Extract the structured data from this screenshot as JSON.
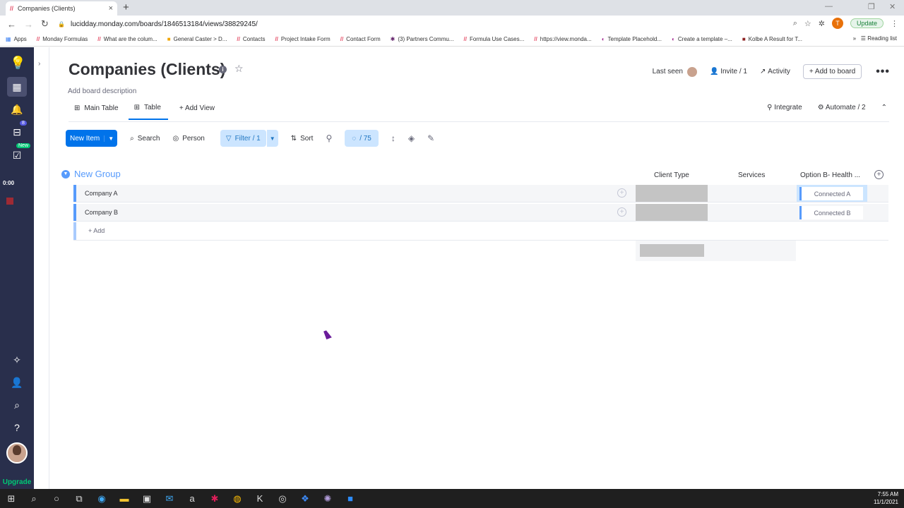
{
  "browser": {
    "tab_title": "Companies (Clients)",
    "url": "lucidday.monday.com/boards/1846513184/views/38829245/",
    "update_label": "Update",
    "profile_initial": "T",
    "bookmarks": [
      "Apps",
      "Monday Formulas",
      "What are the colum...",
      "General Caster > D...",
      "Contacts",
      "Project Intake Form",
      "Contact Form",
      "(3) Partners Commu...",
      "Formula Use Cases...",
      "https://view.monda...",
      "Template Placehold...",
      "Create a template –...",
      "Kolbe A Result for T..."
    ],
    "reading_list": "Reading list"
  },
  "sidebar": {
    "inbox_badge": "8",
    "new_badge": "New",
    "timer": "0:00",
    "upgrade": "Upgrade"
  },
  "board": {
    "title": "Companies (Clients)",
    "description": "Add board description",
    "last_seen": "Last seen",
    "invite": "Invite / 1",
    "activity": "Activity",
    "add_to_board": "Add to board",
    "more": "•••"
  },
  "views": {
    "main_table": "Main Table",
    "table": "Table",
    "add_view": "+ Add View",
    "integrate": "Integrate",
    "automate": "Automate / 2"
  },
  "toolbar": {
    "new_item": "New Item",
    "search": "Search",
    "person": "Person",
    "filter": "Filter / 1",
    "sort": "Sort",
    "hidden": "/ 75"
  },
  "group": {
    "title": "New Group",
    "columns": [
      "Client Type",
      "Services",
      "Option B- Health ..."
    ],
    "rows": [
      {
        "name": "Company A",
        "connected": "Connected A"
      },
      {
        "name": "Company B",
        "connected": "Connected B"
      }
    ],
    "add_label": "+ Add"
  },
  "taskbar": {
    "time": "7:55 AM",
    "date": "11/1/2021"
  },
  "colors": {
    "primary": "#0073ea",
    "sidebar": "#292f4c",
    "group": "#579bfc",
    "upgrade": "#00c875"
  }
}
